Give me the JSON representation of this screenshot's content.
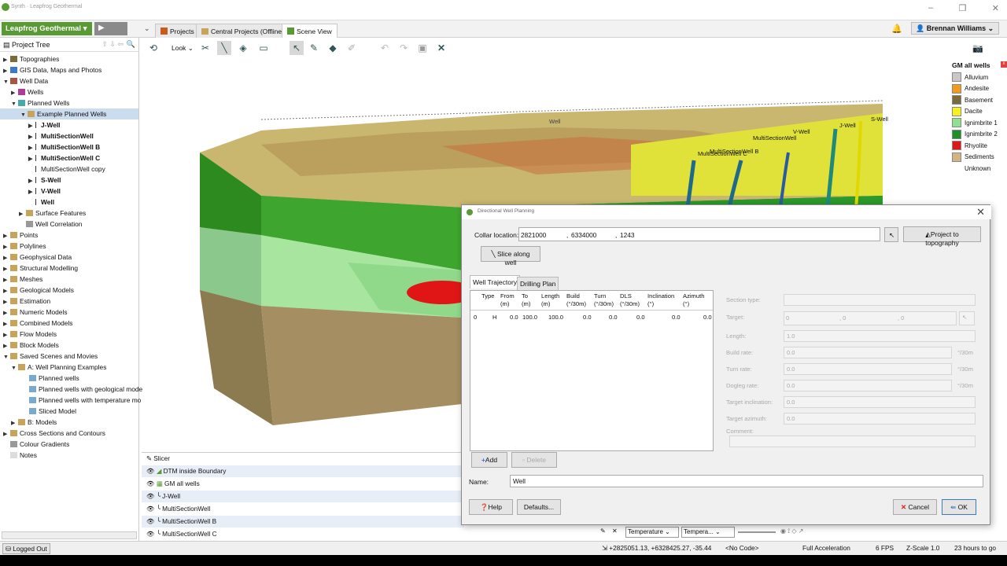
{
  "window": {
    "title": "Synth · Leapfrog Geothermal"
  },
  "app": {
    "button_label": "Leapfrog Geothermal",
    "play_label": "▶"
  },
  "tabs": [
    {
      "label": "Projects"
    },
    {
      "label": "Central Projects (Offline)"
    },
    {
      "label": "Scene View"
    }
  ],
  "user": {
    "name": "Brennan Williams"
  },
  "project_tree": {
    "header": "Project Tree",
    "items": [
      {
        "label": "Topographies"
      },
      {
        "label": "GIS Data, Maps and Photos"
      },
      {
        "label": "Well Data"
      },
      {
        "label": "Wells"
      },
      {
        "label": "Planned Wells"
      },
      {
        "label": "Example Planned Wells"
      },
      {
        "label": "J-Well"
      },
      {
        "label": "MultiSectionWell"
      },
      {
        "label": "MultiSectionWell B"
      },
      {
        "label": "MultiSectionWell C"
      },
      {
        "label": "MultiSectionWell copy"
      },
      {
        "label": "S-Well"
      },
      {
        "label": "V-Well"
      },
      {
        "label": "Well"
      },
      {
        "label": "Surface Features"
      },
      {
        "label": "Well Correlation"
      },
      {
        "label": "Points"
      },
      {
        "label": "Polylines"
      },
      {
        "label": "Geophysical Data"
      },
      {
        "label": "Structural Modelling"
      },
      {
        "label": "Meshes"
      },
      {
        "label": "Geological Models"
      },
      {
        "label": "Estimation"
      },
      {
        "label": "Numeric Models"
      },
      {
        "label": "Combined Models"
      },
      {
        "label": "Flow Models"
      },
      {
        "label": "Block Models"
      },
      {
        "label": "Saved Scenes and Movies"
      },
      {
        "label": "A: Well Planning Examples"
      },
      {
        "label": "Planned wells"
      },
      {
        "label": "Planned wells with geological mode"
      },
      {
        "label": "Planned wells with temperature mo"
      },
      {
        "label": "Sliced Model"
      },
      {
        "label": "B: Models"
      },
      {
        "label": "Cross Sections and Contours"
      },
      {
        "label": "Colour Gradients"
      },
      {
        "label": "Notes"
      }
    ]
  },
  "scene_toolbar": {
    "look_label": "Look"
  },
  "scene_labels": {
    "well": "Well",
    "swell": "S-Well",
    "jwell": "J-Well",
    "vwell": "V-Well",
    "msw": "MultiSectionWell",
    "mswb": "MultiSectionWell B",
    "mswc": "MultiSectionWell C"
  },
  "legend": {
    "title": "GM all wells",
    "items": [
      {
        "label": "Alluvium",
        "color": "#c8c8c8"
      },
      {
        "label": "Andesite",
        "color": "#f29a1c"
      },
      {
        "label": "Basement",
        "color": "#7a6a3c"
      },
      {
        "label": "Dacite",
        "color": "#f7f01e"
      },
      {
        "label": "Ignimbrite 1",
        "color": "#8fe08f"
      },
      {
        "label": "Ignimbrite 2",
        "color": "#1f8f2a"
      },
      {
        "label": "Rhyolite",
        "color": "#e01616"
      },
      {
        "label": "Sediments",
        "color": "#d4b483"
      },
      {
        "label": "Unknown",
        "color": "#ffffff"
      }
    ]
  },
  "shown_items": [
    {
      "label": "Slicer"
    },
    {
      "label": "DTM inside Boundary"
    },
    {
      "label": "GM all wells"
    },
    {
      "label": "J-Well"
    },
    {
      "label": "MultiSectionWell"
    },
    {
      "label": "MultiSectionWell B"
    },
    {
      "label": "MultiSectionWell C"
    }
  ],
  "status": {
    "logged_out": "Logged Out",
    "coords": "+2825051.13, +6328425.27, -35.44",
    "no_code": "<No Code>",
    "accel": "Full Acceleration",
    "fps": "6 FPS",
    "zscale": "Z-Scale 1.0",
    "time": "23 hours to go",
    "color_select": "Temperature",
    "gradient_select": "Tempera..."
  },
  "dialog": {
    "title": "Directional Well Planning",
    "collar_label": "Collar location:",
    "collar_x": "2821000",
    "collar_y": "6334000",
    "collar_z": "1243",
    "project_btn": "Project to topography",
    "slice_btn": "Slice along well",
    "tab_trajectory": "Well Trajectory",
    "tab_drilling": "Drilling Plan",
    "columns": [
      "Type",
      "From (m)",
      "To (m)",
      "Length (m)",
      "Build (°/30m)",
      "Turn (°/30m)",
      "DLS (°/30m)",
      "Inclination (°)",
      "Azimuth (°)"
    ],
    "row": {
      "index": "0",
      "type": "H",
      "from": "0.0",
      "to": "100.0",
      "length": "100.0",
      "build": "0.0",
      "turn": "0.0",
      "dls": "0.0",
      "inclination": "0.0",
      "azimuth": "0.0"
    },
    "section_type_label": "Section type:",
    "target_label": "Target:",
    "target_x": "0",
    "target_y": "0",
    "target_z": "0",
    "length_label": "Length:",
    "length_val": "1.0",
    "build_label": "Build rate:",
    "build_val": "0.0",
    "turn_label": "Turn rate:",
    "turn_val": "0.0",
    "dogleg_label": "Dogleg rate:",
    "dogleg_val": "0.0",
    "tinc_label": "Target inclination:",
    "tinc_val": "0.0",
    "taz_label": "Target azimuth:",
    "taz_val": "0.0",
    "comment_label": "Comment:",
    "unit": "°/30m",
    "add_btn": "Add",
    "delete_btn": "Delete",
    "name_label": "Name:",
    "name_val": "Well",
    "help_btn": "Help",
    "defaults_btn": "Defaults...",
    "cancel_btn": "Cancel",
    "ok_btn": "OK"
  }
}
